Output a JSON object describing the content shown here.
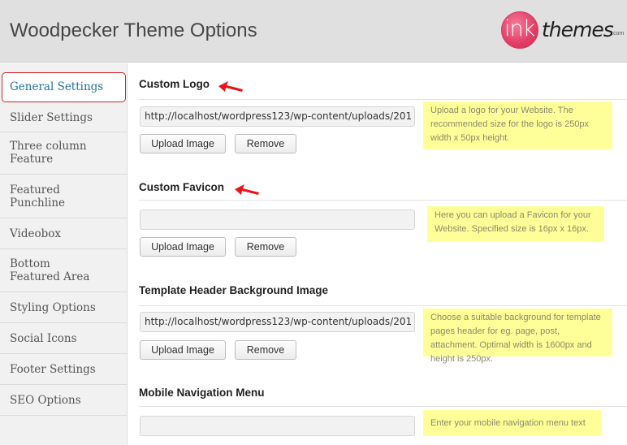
{
  "header": {
    "title": "Woodpecker Theme Options",
    "logo": {
      "ink": "ink",
      "themes": "themes",
      "com": ".com",
      "brand_color": "#e23e66"
    }
  },
  "sidebar": {
    "items": [
      {
        "label": "General Settings",
        "active": true
      },
      {
        "label": "Slider Settings"
      },
      {
        "label": "Three column Feature"
      },
      {
        "label": "Featured Punchline"
      },
      {
        "label": "Videobox"
      },
      {
        "label": "Bottom Featured Area"
      },
      {
        "label": "Styling Options"
      },
      {
        "label": "Social Icons"
      },
      {
        "label": "Footer Settings"
      },
      {
        "label": "SEO Options"
      }
    ]
  },
  "sections": [
    {
      "title": "Custom Logo",
      "value": "http://localhost/wordpress123/wp-content/uploads/201",
      "upload_label": "Upload Image",
      "remove_label": "Remove",
      "help": "Upload a logo for your Website. The recommended size for the logo is 250px width x 50px height.",
      "annotated": true
    },
    {
      "title": "Custom Favicon",
      "value": "",
      "upload_label": "Upload Image",
      "remove_label": "Remove",
      "help": "Here you can upload a Favicon for your Website. Specified size is 16px x 16px.",
      "annotated": true
    },
    {
      "title": "Template Header Background Image",
      "value": "http://localhost/wordpress123/wp-content/uploads/201",
      "upload_label": "Upload Image",
      "remove_label": "Remove",
      "help": "Choose a suitable background for template pages header for eg. page, post, attachment. Optimal width is 1600px and height is 250px."
    },
    {
      "title": "Mobile Navigation Menu",
      "value": "",
      "help": "Enter your mobile navigation menu text"
    }
  ],
  "colors": {
    "annotation_arrow": "#e8141b",
    "active_nav_border": "#d8232a",
    "active_nav_text": "#21759b",
    "help_background": "#ffff99"
  }
}
